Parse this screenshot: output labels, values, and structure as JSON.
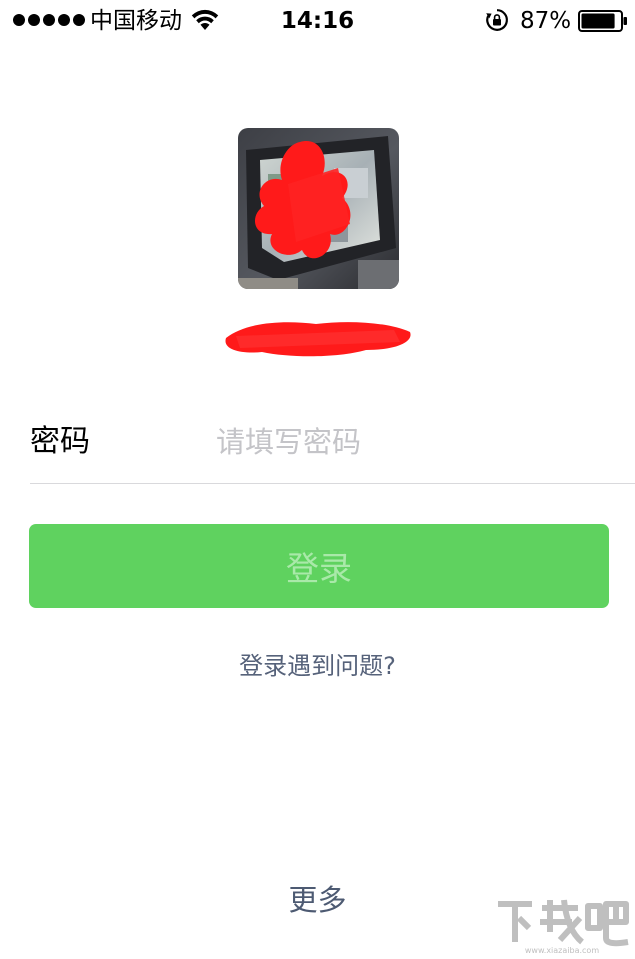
{
  "status_bar": {
    "carrier": "中国移动",
    "time": "14:16",
    "battery_percent": "87%",
    "battery_level": 0.87,
    "icons": [
      "signal-dots",
      "wifi-icon",
      "rotation-lock-icon",
      "battery-icon"
    ]
  },
  "account": {
    "avatar_icon": "avatar-image-redacted",
    "username_redacted": true
  },
  "password": {
    "label": "密码",
    "placeholder": "请填写密码",
    "value": ""
  },
  "login_button": {
    "label": "登录",
    "enabled": false
  },
  "links": {
    "trouble": "登录遇到问题?",
    "more": "更多"
  },
  "watermark": {
    "brand": "下载吧",
    "url": "www.xiazaiba.com"
  },
  "colors": {
    "primary_green": "#5fd25f",
    "disabled_text": "#a9e9a9",
    "link": "#56627a",
    "placeholder": "#c4c4c8",
    "redaction": "#ff1a1a"
  }
}
